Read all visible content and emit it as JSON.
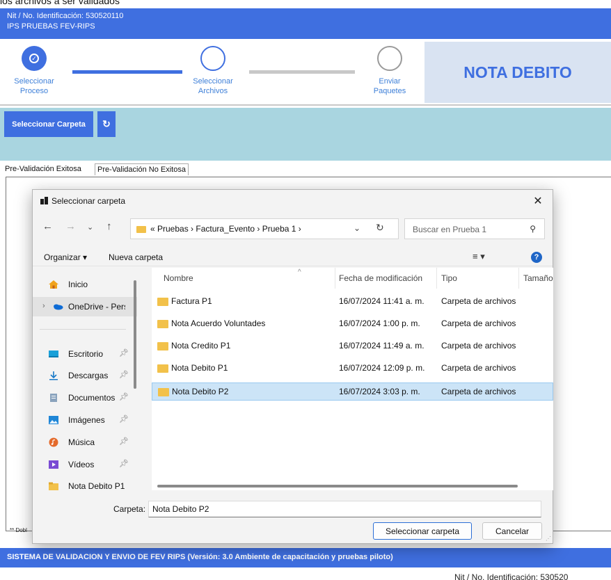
{
  "caption": "los archivos a ser validados",
  "header": {
    "nit": "Nit / No. Identificación: 530520110",
    "company": "IPS PRUEBAS FEV-RIPS"
  },
  "steps": [
    {
      "label1": "Seleccionar",
      "label2": "Proceso",
      "state": "done"
    },
    {
      "label1": "Seleccionar",
      "label2": "Archivos",
      "state": "current"
    },
    {
      "label1": "Enviar",
      "label2": "Paquetes",
      "state": "pending"
    }
  ],
  "document_type": "NOTA DEBITO",
  "toolbar": {
    "select_folder": "Seleccionar Carpeta",
    "refresh_icon": "refresh-icon"
  },
  "tabs": [
    "Pre-Validación Exitosa",
    "Pre-Validación No Exitosa"
  ],
  "footnote": "** Dobl",
  "footer": "SISTEMA DE VALIDACION Y ENVIO DE FEV RIPS  (Versión: 3.0 Ambiente de capacitación y pruebas piloto)",
  "bottom_text": "Nit / No. Identificación: 530520",
  "dialog": {
    "title": "Seleccionar carpeta",
    "close": "✕",
    "breadcrumb": "«  Pruebas  ›  Factura_Evento  ›  Prueba 1  ›",
    "search_placeholder": "Buscar en Prueba 1",
    "organize": "Organizar ▾",
    "new_folder": "Nueva carpeta",
    "view": "≡ ▾",
    "help": "?",
    "nav": [
      {
        "label": "Inicio",
        "icon": "home-icon",
        "pinned": false
      },
      {
        "label": "OneDrive - Perso",
        "icon": "onedrive-icon",
        "pinned": false
      },
      {
        "label": "Escritorio",
        "icon": "desktop-icon",
        "pinned": true
      },
      {
        "label": "Descargas",
        "icon": "download-icon",
        "pinned": true
      },
      {
        "label": "Documentos",
        "icon": "documents-icon",
        "pinned": true
      },
      {
        "label": "Imágenes",
        "icon": "pictures-icon",
        "pinned": true
      },
      {
        "label": "Música",
        "icon": "music-icon",
        "pinned": true
      },
      {
        "label": "Vídeos",
        "icon": "videos-icon",
        "pinned": true
      },
      {
        "label": "Nota Debito P1",
        "icon": "folder-icon",
        "pinned": false
      }
    ],
    "columns": [
      "Nombre",
      "Fecha de modificación",
      "Tipo",
      "Tamaño"
    ],
    "rows": [
      {
        "name": "Factura P1",
        "date": "16/07/2024 11:41 a. m.",
        "type": "Carpeta de archivos",
        "selected": false
      },
      {
        "name": "Nota Acuerdo Voluntades",
        "date": "16/07/2024 1:00 p. m.",
        "type": "Carpeta de archivos",
        "selected": false
      },
      {
        "name": "Nota Credito P1",
        "date": "16/07/2024 11:49 a. m.",
        "type": "Carpeta de archivos",
        "selected": false
      },
      {
        "name": "Nota Debito P1",
        "date": "16/07/2024 12:09 p. m.",
        "type": "Carpeta de archivos",
        "selected": false
      },
      {
        "name": "Nota Debito P2",
        "date": "16/07/2024 3:03 p. m.",
        "type": "Carpeta de archivos",
        "selected": true
      }
    ],
    "folder_label": "Carpeta:",
    "folder_value": "Nota Debito P2",
    "ok": "Seleccionar carpeta",
    "cancel": "Cancelar"
  }
}
